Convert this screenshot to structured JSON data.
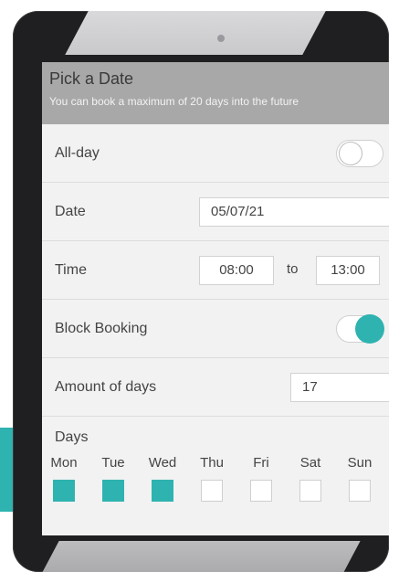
{
  "header": {
    "title": "Pick a Date",
    "subtitle": "You can book a maximum of 20 days into the future"
  },
  "all_day": {
    "label": "All-day",
    "enabled": false
  },
  "date": {
    "label": "Date",
    "value": "05/07/21"
  },
  "time": {
    "label": "Time",
    "from": "08:00",
    "to_label": "to",
    "to": "13:00"
  },
  "block_booking": {
    "label": "Block Booking",
    "enabled": true
  },
  "amount": {
    "label": "Amount of days",
    "value": "17"
  },
  "days": {
    "label": "Days",
    "items": [
      {
        "label": "Mon",
        "checked": true
      },
      {
        "label": "Tue",
        "checked": true
      },
      {
        "label": "Wed",
        "checked": true
      },
      {
        "label": "Thu",
        "checked": false
      },
      {
        "label": "Fri",
        "checked": false
      },
      {
        "label": "Sat",
        "checked": false
      },
      {
        "label": "Sun",
        "checked": false
      }
    ]
  },
  "colors": {
    "accent": "#2fb3b0",
    "header": "#a8a8a8",
    "bezel": "#1f1f21"
  }
}
